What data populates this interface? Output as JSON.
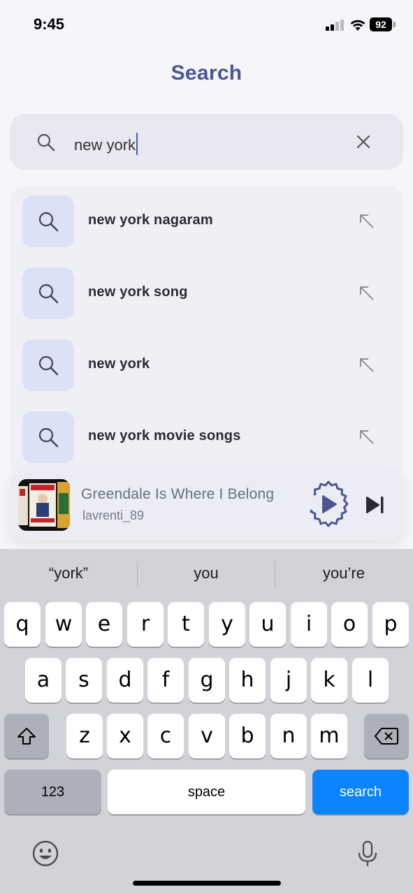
{
  "status_bar": {
    "time": "9:45",
    "battery": "92"
  },
  "header": {
    "title": "Search"
  },
  "search": {
    "query": "new york"
  },
  "suggestions": [
    {
      "label": "new york nagaram"
    },
    {
      "label": "new york song"
    },
    {
      "label": "new york"
    },
    {
      "label": "new york movie songs"
    }
  ],
  "player": {
    "title": "Greendale Is Where I Belong",
    "artist": "lavrenti_89"
  },
  "keyboard": {
    "predictions": [
      "“york”",
      "you",
      "you’re"
    ],
    "row1": [
      "q",
      "w",
      "e",
      "r",
      "t",
      "y",
      "u",
      "i",
      "o",
      "p"
    ],
    "row2": [
      "a",
      "s",
      "d",
      "f",
      "g",
      "h",
      "j",
      "k",
      "l"
    ],
    "row3": [
      "z",
      "x",
      "c",
      "v",
      "b",
      "n",
      "m"
    ],
    "numbers_label": "123",
    "space_label": "space",
    "search_label": "search"
  },
  "colors": {
    "accent": "#4a5893",
    "keyboard_action": "#0a84ff",
    "suggestion_tile": "#dde1f5"
  },
  "icons": {
    "search": "magnifier-icon",
    "clear": "x-icon",
    "suggestion_fill": "arrow-up-left-icon",
    "play": "play-icon",
    "next": "skip-forward-icon",
    "shift": "shift-icon",
    "delete": "backspace-icon",
    "emoji": "emoji-icon",
    "mic": "microphone-icon"
  }
}
